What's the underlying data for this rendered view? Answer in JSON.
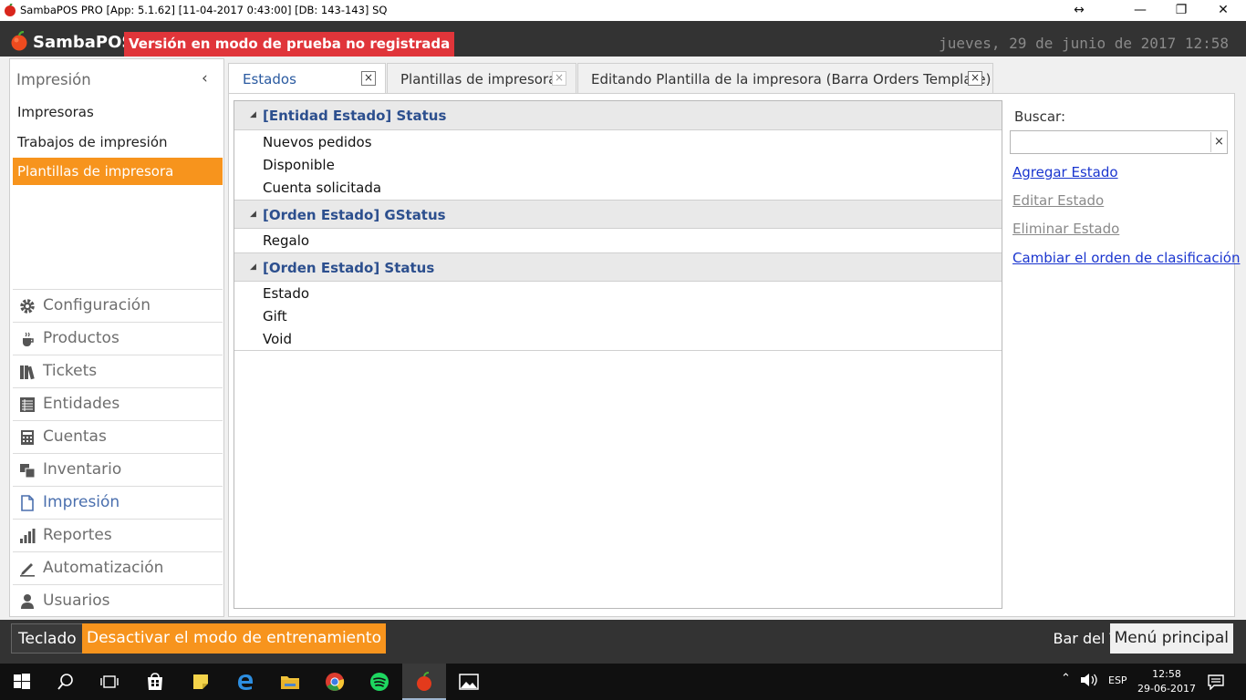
{
  "window": {
    "title": "SambaPOS PRO [App: 5.1.62] [11-04-2017 0:43:00] [DB: 143-143] SQ",
    "controls": {
      "resize": "↔",
      "minimize": "—",
      "restore": "❐",
      "close": "✕"
    }
  },
  "header": {
    "brand": "SambaPOS",
    "trial_banner": "Versión en modo de prueba no registrada",
    "datetime": "jueves, 29 de junio de 2017 12:58"
  },
  "sidebar": {
    "title": "Impresión",
    "collapse_icon": "chevron-left-icon",
    "items": [
      {
        "label": "Impresoras",
        "selected": false
      },
      {
        "label": "Trabajos de impresión",
        "selected": false
      },
      {
        "label": "Plantillas de impresora",
        "selected": true
      }
    ],
    "nav": [
      {
        "label": "Configuración",
        "icon": "gear-icon"
      },
      {
        "label": "Productos",
        "icon": "coffee-cup-icon"
      },
      {
        "label": "Tickets",
        "icon": "books-icon"
      },
      {
        "label": "Entidades",
        "icon": "table-list-icon"
      },
      {
        "label": "Cuentas",
        "icon": "calculator-icon"
      },
      {
        "label": "Inventario",
        "icon": "inventory-icon"
      },
      {
        "label": "Impresión",
        "icon": "document-icon",
        "active": true
      },
      {
        "label": "Reportes",
        "icon": "bar-chart-icon"
      },
      {
        "label": "Automatización",
        "icon": "pencil-icon"
      },
      {
        "label": "Usuarios",
        "icon": "user-icon"
      }
    ]
  },
  "tabs": [
    {
      "label": "Estados",
      "active": true
    },
    {
      "label": "Plantillas de impresora",
      "active": false
    },
    {
      "label": "Editando Plantilla de la impresora (Barra Orders Template)",
      "active": false
    }
  ],
  "tab_close_glyph": "×",
  "groups": [
    {
      "label": "[Entidad Estado] Status",
      "items": [
        "Nuevos pedidos",
        "Disponible",
        "Cuenta solicitada"
      ]
    },
    {
      "label": "[Orden Estado] GStatus",
      "items": [
        "Regalo"
      ]
    },
    {
      "label": "[Orden Estado] Status",
      "items": [
        "Estado",
        "Gift",
        "Void"
      ]
    }
  ],
  "right_panel": {
    "search_label": "Buscar:",
    "search_value": "",
    "clear_glyph": "×",
    "actions": [
      {
        "label": "Agregar Estado",
        "enabled": true
      },
      {
        "label": "Editar Estado",
        "enabled": false
      },
      {
        "label": "Eliminar Estado",
        "enabled": false
      },
      {
        "label": "Cambiar el orden de clasificación",
        "enabled": true
      }
    ]
  },
  "bottom": {
    "keyboard": "Teclado",
    "training": "Desactivar el modo de entrenamiento",
    "location": "Bar del Tio",
    "main_menu": "Menú principal"
  },
  "taskbar": {
    "apps": [
      "start-icon",
      "search-icon",
      "task-view-icon",
      "store-icon",
      "notes-icon",
      "edge-icon",
      "file-explorer-icon",
      "chrome-icon",
      "spotify-icon",
      "sambapos-icon",
      "photos-icon"
    ],
    "lang": "ESP",
    "time": "12:58",
    "date": "29-06-2017"
  },
  "colors": {
    "accent_orange": "#f7941d",
    "trial_red": "#e0353a",
    "header_dark": "#333333",
    "group_text": "#2c4f8e",
    "link_blue": "#1a35cf"
  }
}
